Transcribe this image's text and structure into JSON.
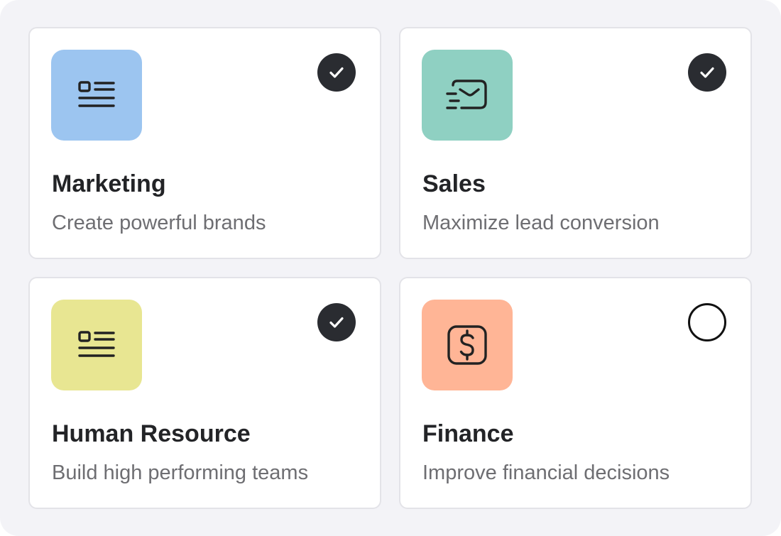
{
  "cards": [
    {
      "title": "Marketing",
      "subtitle": "Create powerful brands",
      "icon": "document-list-icon",
      "tile_color": "#9cc5f0",
      "selected": true
    },
    {
      "title": "Sales",
      "subtitle": "Maximize lead conversion",
      "icon": "fast-mail-icon",
      "tile_color": "#8fd0c2",
      "selected": true
    },
    {
      "title": "Human Resource",
      "subtitle": "Build high performing teams",
      "icon": "document-list-icon",
      "tile_color": "#e8e692",
      "selected": true
    },
    {
      "title": "Finance",
      "subtitle": "Improve financial decisions",
      "icon": "dollar-square-icon",
      "tile_color": "#ffb596",
      "selected": false
    }
  ],
  "colors": {
    "background": "#f3f3f7",
    "check_fill": "#2a2c31",
    "title": "#232427",
    "subtitle": "#6e6e72"
  }
}
